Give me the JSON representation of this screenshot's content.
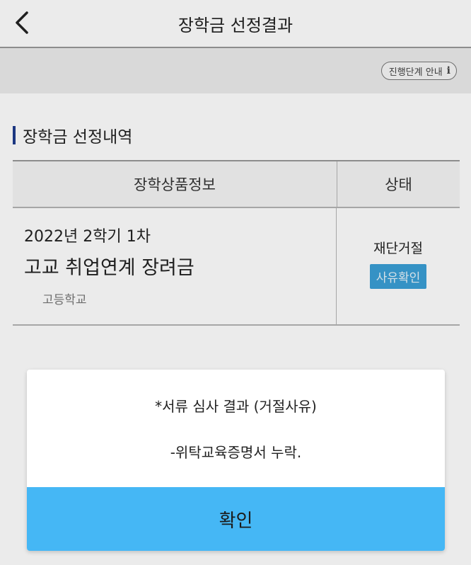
{
  "header": {
    "title": "장학금 선정결과",
    "back_icon": "chevron-left-icon"
  },
  "subbar": {
    "guide_label": "진행단계 안내",
    "info_icon": "i"
  },
  "section": {
    "title": "장학금 선정내역",
    "accent_color": "#1f3c8c"
  },
  "table": {
    "columns": [
      "장학상품정보",
      "상태"
    ],
    "rows": [
      {
        "term": "2022년 2학기 1차",
        "product": "고교 취업연계 장려금",
        "school": "고등학교",
        "status": "재단거절",
        "reason_button": "사유확인"
      }
    ]
  },
  "dialog": {
    "line1": "*서류 심사 결과 (거절사유)",
    "line2": "-위탁교육증명서 누락.",
    "confirm_label": "확인",
    "confirm_color": "#45b7f5"
  }
}
